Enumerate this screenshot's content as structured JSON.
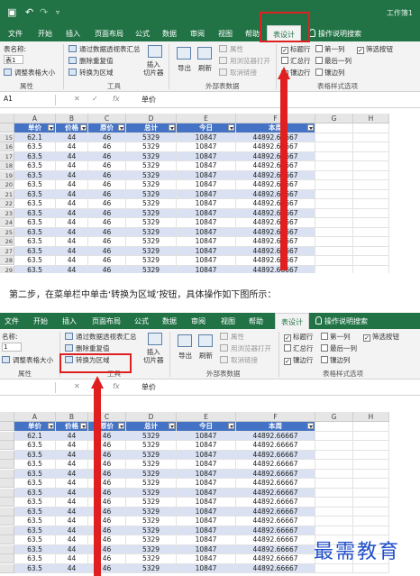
{
  "screenshots": [
    {
      "workbook_name": "工作簿1",
      "tabs": [
        "文件",
        "开始",
        "插入",
        "页面布局",
        "公式",
        "数据",
        "审阅",
        "视图",
        "帮助",
        "表设计",
        "操作说明搜索"
      ],
      "active_tab": "表设计",
      "ribbon": {
        "table_name_label": "表名称:",
        "table_name_value": "表1",
        "resize_label": "调整表格大小",
        "props_group": "属性",
        "pivot_label": "通过数据透视表汇总",
        "dedupe_label": "删除重复值",
        "convert_label": "转换为区域",
        "slicer_label": "插入\n切片器",
        "tools_group": "工具",
        "export_label": "导出",
        "refresh_label": "刷新",
        "properties_label": "属性",
        "open_browser_label": "用浏览器打开",
        "unlink_label": "取消链接",
        "external_group": "外部表数据",
        "header_row_label": "标题行",
        "first_col_label": "第一列",
        "filter_btn_label": "筛选按钮",
        "total_row_label": "汇总行",
        "last_col_label": "最后一列",
        "banded_rows_label": "镶边行",
        "banded_cols_label": "镶边列",
        "style_opts_group": "表格样式选项"
      },
      "formula_bar": {
        "name_box": "A1",
        "fx": "fx",
        "value": "单价"
      },
      "columns": [
        "A",
        "B",
        "C",
        "D",
        "E",
        "F",
        "G",
        "H"
      ],
      "table_headers": [
        "单价",
        "价格",
        "原价",
        "总计",
        "今日",
        "本周"
      ],
      "row_numbers": [
        "15",
        "16",
        "17",
        "18",
        "19",
        "20",
        "21",
        "22",
        "23",
        "24",
        "25",
        "26",
        "27",
        "28",
        "29"
      ],
      "rows": [
        [
          "62.1",
          "44",
          "46",
          "5329",
          "10847",
          "44892.66667"
        ],
        [
          "63.5",
          "44",
          "46",
          "5329",
          "10847",
          "44892.66667"
        ],
        [
          "63.5",
          "44",
          "46",
          "5329",
          "10847",
          "44892.66667"
        ],
        [
          "63.5",
          "44",
          "46",
          "5329",
          "10847",
          "44892.66667"
        ],
        [
          "63.5",
          "44",
          "46",
          "5329",
          "10847",
          "44892.66667"
        ],
        [
          "63.5",
          "44",
          "46",
          "5329",
          "10847",
          "44892.66667"
        ],
        [
          "63.5",
          "44",
          "46",
          "5329",
          "10847",
          "44892.66667"
        ],
        [
          "63.5",
          "44",
          "46",
          "5329",
          "10847",
          "44892.66667"
        ],
        [
          "63.5",
          "44",
          "46",
          "5329",
          "10847",
          "44892.66667"
        ],
        [
          "63.5",
          "44",
          "46",
          "5329",
          "10847",
          "44892.66667"
        ],
        [
          "63.5",
          "44",
          "46",
          "5329",
          "10847",
          "44892.66667"
        ],
        [
          "63.5",
          "44",
          "46",
          "5329",
          "10847",
          "44892.66667"
        ],
        [
          "63.5",
          "44",
          "46",
          "5329",
          "10847",
          "44892.66667"
        ],
        [
          "63.5",
          "44",
          "46",
          "5329",
          "10847",
          "44892.66667"
        ],
        [
          "63.5",
          "44",
          "46",
          "5329",
          "10847",
          "44892.66667"
        ]
      ]
    },
    {
      "tabs": [
        "文件",
        "开始",
        "插入",
        "页面布局",
        "公式",
        "数据",
        "审阅",
        "视图",
        "帮助",
        "表设计",
        "操作说明搜索"
      ],
      "active_tab": "表设计",
      "ribbon": {
        "table_name_label": "名称:",
        "table_name_value": "1",
        "resize_label": "调整表格大小",
        "props_group": "属性",
        "pivot_label": "通过数据透视表汇总",
        "dedupe_label": "删除重复值",
        "convert_label": "转换为区域",
        "slicer_label": "插入\n切片器",
        "tools_group": "工具",
        "export_label": "导出",
        "refresh_label": "刷新",
        "properties_label": "属性",
        "open_browser_label": "用浏览器打开",
        "unlink_label": "取消链接",
        "external_group": "外部表数据",
        "header_row_label": "标题行",
        "first_col_label": "第一列",
        "filter_btn_label": "筛选按钮",
        "total_row_label": "汇总行",
        "last_col_label": "最后一列",
        "banded_rows_label": "镶边行",
        "banded_cols_label": "镶边列",
        "style_opts_group": "表格样式选项"
      },
      "formula_bar": {
        "name_box": "",
        "fx": "fx",
        "value": "单价"
      },
      "columns": [
        "A",
        "B",
        "C",
        "D",
        "E",
        "F",
        "G",
        "H"
      ],
      "table_headers": [
        "单价",
        "价格",
        "原价",
        "总计",
        "今日",
        "本周"
      ],
      "rows": [
        [
          "62.1",
          "44",
          "46",
          "5329",
          "10847",
          "44892.66667"
        ],
        [
          "63.5",
          "44",
          "46",
          "5329",
          "10847",
          "44892.66667"
        ],
        [
          "63.5",
          "44",
          "46",
          "5329",
          "10847",
          "44892.66667"
        ],
        [
          "63.5",
          "44",
          "46",
          "5329",
          "10847",
          "44892.66667"
        ],
        [
          "63.5",
          "44",
          "46",
          "5329",
          "10847",
          "44892.66667"
        ],
        [
          "63.5",
          "44",
          "46",
          "5329",
          "10847",
          "44892.66667"
        ],
        [
          "63.5",
          "44",
          "46",
          "5329",
          "10847",
          "44892.66667"
        ],
        [
          "63.5",
          "44",
          "46",
          "5329",
          "10847",
          "44892.66667"
        ],
        [
          "63.5",
          "44",
          "46",
          "5329",
          "10847",
          "44892.66667"
        ],
        [
          "63.5",
          "44",
          "46",
          "5329",
          "10847",
          "44892.66667"
        ],
        [
          "63.5",
          "44",
          "46",
          "5329",
          "10847",
          "44892.66667"
        ],
        [
          "63.5",
          "44",
          "46",
          "5329",
          "10847",
          "44892.66667"
        ],
        [
          "63.5",
          "44",
          "46",
          "5329",
          "10847",
          "44892.66667"
        ],
        [
          "63.5",
          "44",
          "46",
          "5329",
          "10847",
          "44892.66667"
        ],
        [
          "63.5",
          "44",
          "46",
          "5329",
          "10847",
          "44892.66667"
        ]
      ]
    }
  ],
  "caption": "第二步，在菜单栏中单击‘转换为区域’按钮，具体操作如下图所示：",
  "watermark": "最需教育",
  "colors": {
    "excel_green": "#217346",
    "table_header_blue": "#4472c4",
    "band_blue": "#d9e1f2",
    "annotation_red": "#e02020",
    "watermark_blue": "#2050c8"
  }
}
